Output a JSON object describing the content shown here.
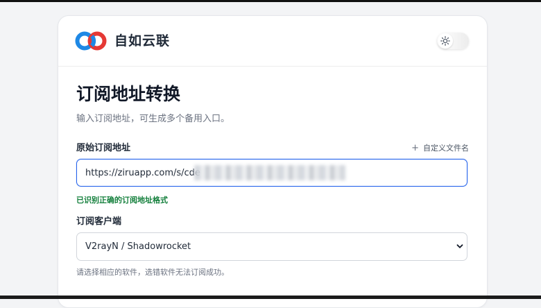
{
  "header": {
    "brand": "自如云联",
    "logo_icon": "linked-rings-logo",
    "theme_toggle_icon": "sun-icon"
  },
  "page": {
    "title": "订阅地址转换",
    "subtitle": "输入订阅地址，可生成多个备用入口。"
  },
  "url_field": {
    "label": "原始订阅地址",
    "custom_filename_label": "自定义文件名",
    "value": "https://ziruapp.com/s/cde",
    "validation_message": "已识别正确的订阅地址格式"
  },
  "client_field": {
    "label": "订阅客户端",
    "selected": "V2rayN / Shadowrocket",
    "hint": "请选择相应的软件，选错软件无法订阅成功。"
  },
  "colors": {
    "accent": "#2563eb",
    "success": "#15803d",
    "logo_red": "#e53935",
    "logo_blue": "#1e88e5"
  }
}
